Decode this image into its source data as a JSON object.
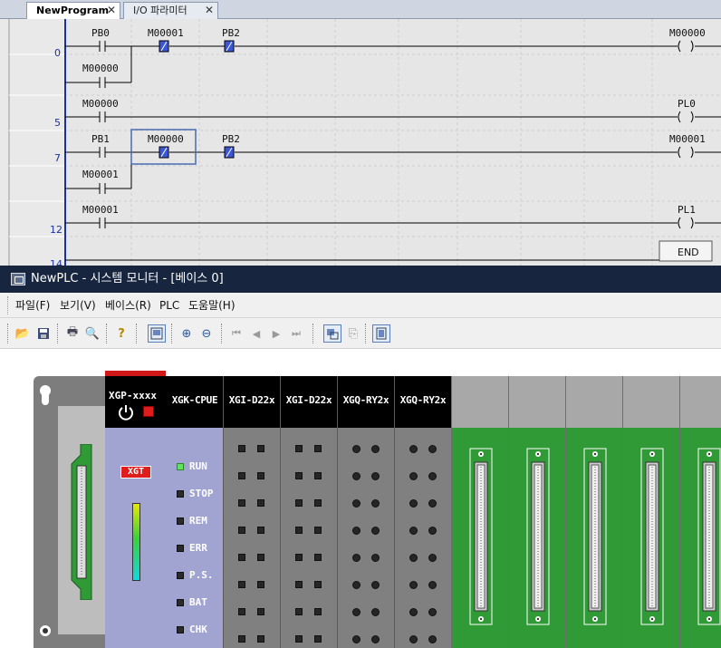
{
  "tabs": [
    {
      "label": "NewProgram",
      "close": "✕"
    },
    {
      "label": "I/O 파라미터",
      "close": "✕"
    }
  ],
  "ladder": {
    "step_numbers": [
      "0",
      "5",
      "7",
      "12",
      "14"
    ],
    "contacts": [
      "PB0",
      "M00001",
      "PB2",
      "M00000",
      "M00000",
      "PB1",
      "M00000",
      "PB2",
      "M00001",
      "M00001"
    ],
    "coils": [
      "M00000",
      "PL0",
      "M00001",
      "PL1"
    ],
    "end_label": "END"
  },
  "monitor": {
    "title": "NewPLC - 시스템 모니터 - [베이스 0]",
    "menu": [
      "파일(F)",
      "보기(V)",
      "베이스(R)",
      "PLC",
      "도움말(H)"
    ]
  },
  "rack": {
    "power_module": "XGP-xxxx",
    "brand": "XGT",
    "cpu_module": "XGK-CPUE",
    "cpu_leds": [
      "RUN",
      "STOP",
      "REM",
      "ERR",
      "P.S.",
      "BAT",
      "CHK"
    ],
    "modules": [
      "XGI-D22x",
      "XGI-D22x",
      "XGQ-RY2x",
      "XGQ-RY2x"
    ]
  },
  "colors": {
    "module_blue": "#a1a3d0",
    "slot_green": "#2f9a36",
    "title_bar": "#17253f",
    "led_run": "#5ee35e"
  }
}
